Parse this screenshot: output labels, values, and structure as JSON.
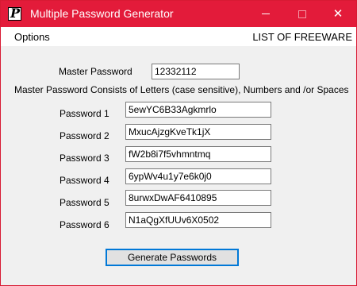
{
  "window": {
    "title": "Multiple Password Generator",
    "icon_letter": "P",
    "minimize_glyph": "—",
    "maximize_glyph": "☐",
    "close_glyph": "✕"
  },
  "menu": {
    "options_label": "Options",
    "freeware_label": "LIST OF FREEWARE"
  },
  "master": {
    "label": "Master Password",
    "value": "12332112",
    "hint": "Master Password Consists of Letters (case sensitive), Numbers and /or Spaces"
  },
  "passwords": [
    {
      "label": "Password 1",
      "value": "5ewYC6B33Agkmrlo"
    },
    {
      "label": "Password 2",
      "value": "MxucAjzgKveTk1jX"
    },
    {
      "label": "Password 3",
      "value": "fW2b8i7f5vhmntmq"
    },
    {
      "label": "Password 4",
      "value": "6ypWv4u1y7e6k0j0"
    },
    {
      "label": "Password 5",
      "value": "8urwxDwAF6410895"
    },
    {
      "label": "Password 6",
      "value": "N1aQgXfUUv6X0502"
    }
  ],
  "generate_button_label": "Generate Passwords",
  "colors": {
    "titlebar": "#e31b3a",
    "button_focus_border": "#0078d7"
  }
}
